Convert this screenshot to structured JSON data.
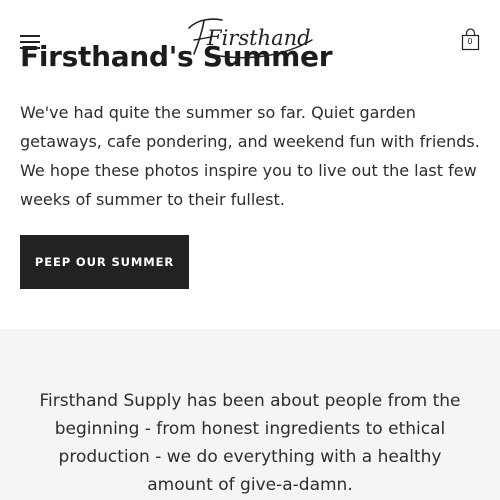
{
  "header": {
    "logo_text": "Firsthand",
    "cart_count": "0",
    "menu_icon": "hamburger-menu-icon",
    "cart_icon": "shopping-bag-icon"
  },
  "hero": {
    "title": "Firsthand's Summer",
    "body": "We've had quite the summer so far. Quiet garden getaways, cafe pondering, and weekend fun with friends. We hope these photos inspire you to live out the last few weeks of summer to their fullest.",
    "button_label": "PEEP OUR SUMMER"
  },
  "about": {
    "text": "Firsthand Supply has been about people from the beginning - from honest ingredients to ethical production - we do everything with a healthy amount of give-a-damn."
  },
  "colors": {
    "button_bg": "#222222",
    "button_text": "#ffffff",
    "section_bg": "#f5f5f5",
    "text": "#2d2d2d"
  }
}
